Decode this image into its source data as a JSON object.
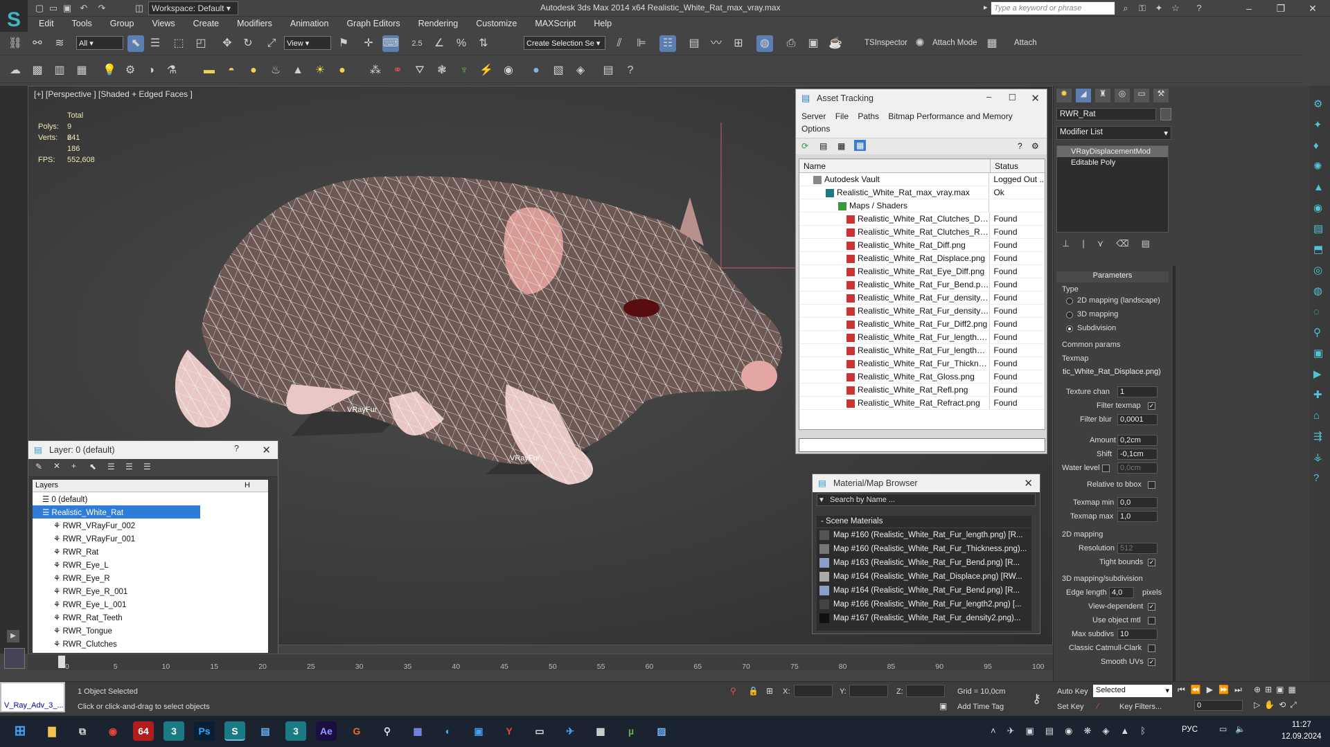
{
  "app": {
    "title": "Autodesk 3ds Max  2014 x64     Realistic_White_Rat_max_vray.max",
    "workspace": "Workspace: Default",
    "search_placeholder": "Type a keyword or phrase"
  },
  "menu": [
    "Edit",
    "Tools",
    "Group",
    "Views",
    "Create",
    "Modifiers",
    "Animation",
    "Graph Editors",
    "Rendering",
    "Customize",
    "MAXScript",
    "Help"
  ],
  "toolbar": {
    "selection_filter": "All",
    "ref_coord": "View",
    "spinner_snap": "2.5",
    "named_selection": "Create Selection Se",
    "tsinspector": "TSInspector",
    "attach_mode": "Attach Mode",
    "attach": "Attach"
  },
  "viewport": {
    "label": "[+] [Perspective ] [Shaded + Edged Faces ]",
    "stats": {
      "total_label": "Total",
      "polys_label": "Polys:",
      "polys": "9 241",
      "verts_label": "Verts:",
      "verts": "6 186",
      "fps_label": "FPS:",
      "fps": "552,608"
    },
    "helper1": "VRayFur",
    "helper2": "VRayFur"
  },
  "asset_tracking": {
    "title": "Asset Tracking",
    "menu": [
      "Server",
      "File",
      "Paths",
      "Bitmap Performance and Memory"
    ],
    "menu2": "Options",
    "col_name": "Name",
    "col_status": "Status",
    "rows": [
      {
        "name": "Autodesk Vault",
        "status": "Logged Out ..."
      },
      {
        "name": "Realistic_White_Rat_max_vray.max",
        "status": "Ok"
      },
      {
        "name": "Maps / Shaders",
        "status": ""
      },
      {
        "name": "Realistic_White_Rat_Clutches_Diff...",
        "status": "Found"
      },
      {
        "name": "Realistic_White_Rat_Clutches_Ref...",
        "status": "Found"
      },
      {
        "name": "Realistic_White_Rat_Diff.png",
        "status": "Found"
      },
      {
        "name": "Realistic_White_Rat_Displace.png",
        "status": "Found"
      },
      {
        "name": "Realistic_White_Rat_Eye_Diff.png",
        "status": "Found"
      },
      {
        "name": "Realistic_White_Rat_Fur_Bend.png",
        "status": "Found"
      },
      {
        "name": "Realistic_White_Rat_Fur_density.p...",
        "status": "Found"
      },
      {
        "name": "Realistic_White_Rat_Fur_density2....",
        "status": "Found"
      },
      {
        "name": "Realistic_White_Rat_Fur_Diff2.png",
        "status": "Found"
      },
      {
        "name": "Realistic_White_Rat_Fur_length.p...",
        "status": "Found"
      },
      {
        "name": "Realistic_White_Rat_Fur_length2....",
        "status": "Found"
      },
      {
        "name": "Realistic_White_Rat_Fur_Thicknes...",
        "status": "Found"
      },
      {
        "name": "Realistic_White_Rat_Gloss.png",
        "status": "Found"
      },
      {
        "name": "Realistic_White_Rat_Refl.png",
        "status": "Found"
      },
      {
        "name": "Realistic_White_Rat_Refract.png",
        "status": "Found"
      }
    ]
  },
  "layer_panel": {
    "title": "Layer: 0 (default)",
    "help": "?",
    "col_layers": "Layers",
    "col_h": "H",
    "rows": [
      "0 (default)",
      "Realistic_White_Rat",
      "RWR_VRayFur_002",
      "RWR_VRayFur_001",
      "RWR_Rat",
      "RWR_Eye_L",
      "RWR_Eye_R",
      "RWR_Eye_R_001",
      "RWR_Eye_L_001",
      "RWR_Rat_Teeth",
      "RWR_Tongue",
      "RWR_Clutches"
    ]
  },
  "material_browser": {
    "title": "Material/Map Browser",
    "search_placeholder": "Search by Name ...",
    "section": "Scene Materials",
    "rows": [
      "Map #160 (Realistic_White_Rat_Fur_length.png) [R...",
      "Map #160 (Realistic_White_Rat_Fur_Thickness.png)...",
      "Map #163 (Realistic_White_Rat_Fur_Bend.png) [R...",
      "Map #164 (Realistic_White_Rat_Displace.png) [RW...",
      "Map #164 (Realistic_White_Rat_Fur_Bend.png) [R...",
      "Map #166 (Realistic_White_Rat_Fur_length2.png) [...",
      "Map #167 (Realistic_White_Rat_Fur_density2.png)..."
    ]
  },
  "command_panel": {
    "object_name": "RWR_Rat",
    "modifier_list": "Modifier List",
    "stack": [
      "VRayDisplacementMod",
      "Editable Poly"
    ],
    "parameters": "Parameters",
    "type_label": "Type",
    "type_2d": "2D mapping (landscape)",
    "type_3d": "3D mapping",
    "type_sub": "Subdivision",
    "common_params": "Common params",
    "texmap_label": "Texmap",
    "texmap_value": "tic_White_Rat_Displace.png)",
    "texture_chan_label": "Texture chan",
    "texture_chan": "1",
    "filter_texmap": "Filter texmap",
    "filter_blur_label": "Filter blur",
    "filter_blur": "0,0001",
    "amount_label": "Amount",
    "amount": "0,2cm",
    "shift_label": "Shift",
    "shift": "-0,1cm",
    "water_level_label": "Water level",
    "water_level": "0,0cm",
    "relative_bbox": "Relative to bbox",
    "texmap_min_label": "Texmap min",
    "texmap_min": "0,0",
    "texmap_max_label": "Texmap max",
    "texmap_max": "1,0",
    "mapping2d": "2D mapping",
    "resolution_label": "Resolution",
    "resolution": "512",
    "tight_bounds": "Tight bounds",
    "mapping3d": "3D mapping/subdivision",
    "edge_length_label": "Edge length",
    "edge_length": "4,0",
    "pixels": "pixels",
    "view_dependent": "View-dependent",
    "use_object_mtl": "Use object mtl",
    "max_subdivs_label": "Max subdivs",
    "max_subdivs": "10",
    "catmull": "Classic Catmull-Clark",
    "smooth_uvs": "Smooth UVs"
  },
  "timeline": {
    "ticks": [
      "0",
      "5",
      "10",
      "15",
      "20",
      "25",
      "30",
      "35",
      "40",
      "45",
      "50",
      "55",
      "60",
      "65",
      "70",
      "75",
      "80",
      "85",
      "90",
      "95",
      "100"
    ],
    "position": "0 / 100"
  },
  "status": {
    "script_box": "V_Ray_Adv_3_...",
    "selected": "1 Object Selected",
    "prompt": "Click or click-and-drag to select objects",
    "x_label": "X:",
    "y_label": "Y:",
    "z_label": "Z:",
    "grid": "Grid = 10,0cm",
    "add_time_tag": "Add Time Tag",
    "auto_key": "Auto Key",
    "set_key": "Set Key",
    "selected_dd": "Selected",
    "key_filters": "Key Filters...",
    "frame": "0"
  },
  "taskbar": {
    "lang": "РУС",
    "time": "11:27",
    "date": "12.09.2024",
    "app64": "64",
    "appPs": "Ps",
    "appAe": "Ae"
  }
}
